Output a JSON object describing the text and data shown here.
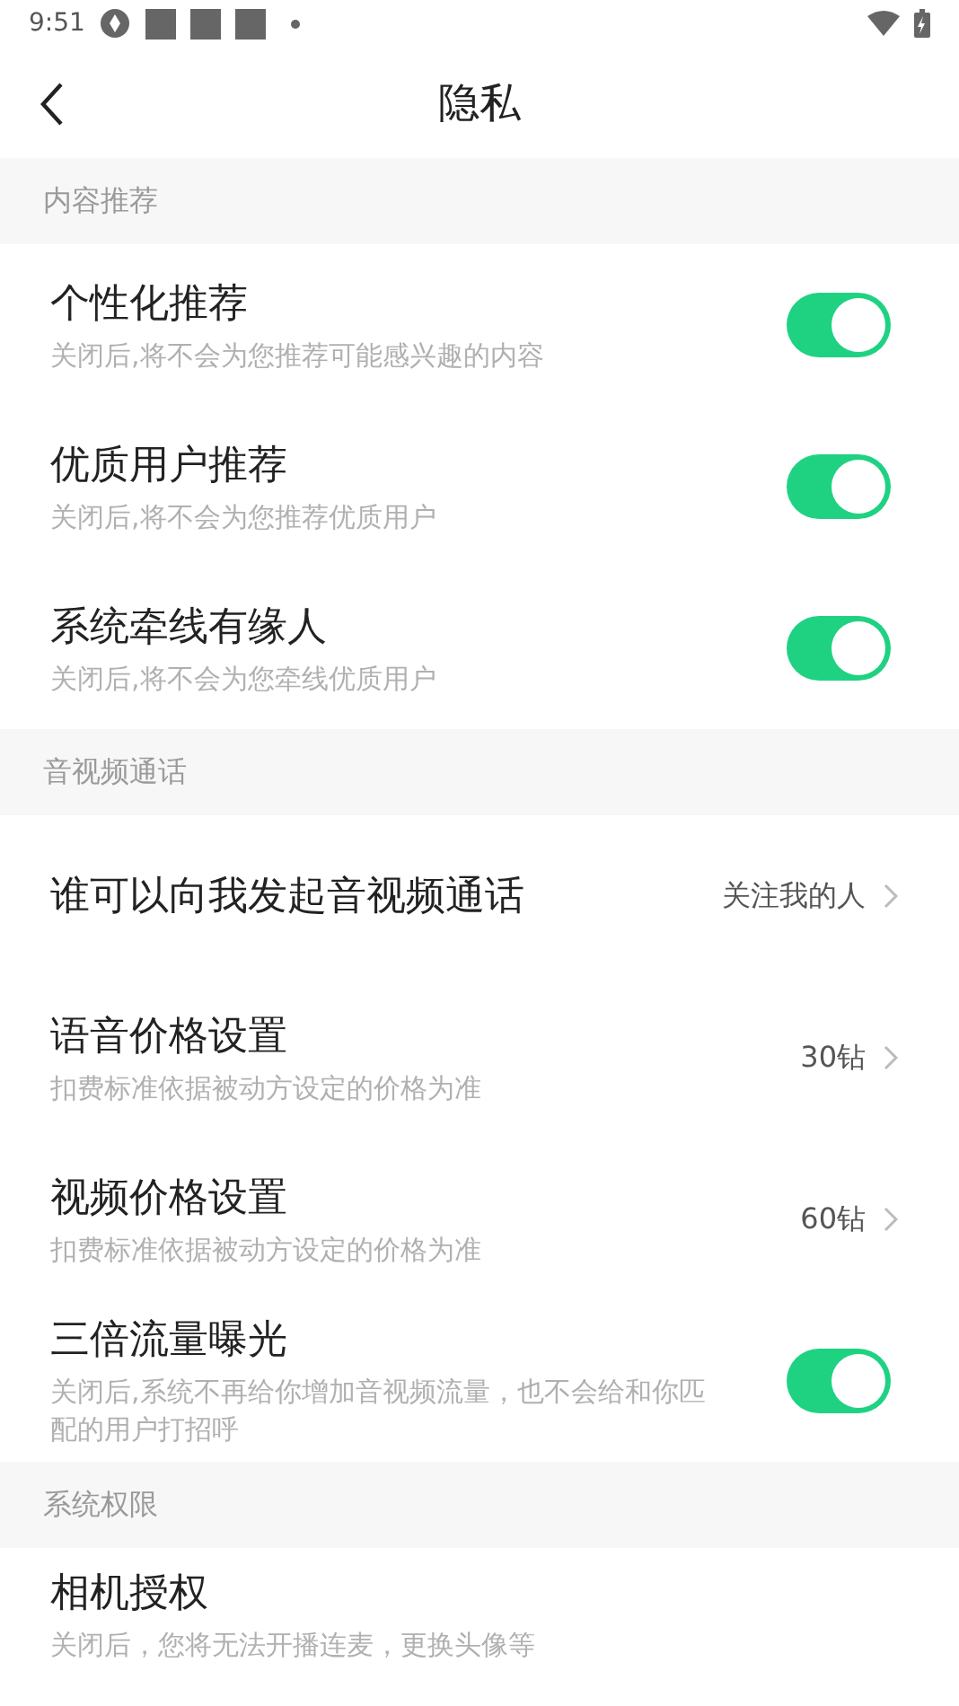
{
  "status_bar": {
    "time": "9:51"
  },
  "header": {
    "title": "隐私"
  },
  "sections": [
    {
      "title": "内容推荐",
      "items": [
        {
          "kind": "toggle",
          "title": "个性化推荐",
          "subtitle": "关闭后,将不会为您推荐可能感兴趣的内容",
          "on": true
        },
        {
          "kind": "toggle",
          "title": "优质用户推荐",
          "subtitle": "关闭后,将不会为您推荐优质用户",
          "on": true
        },
        {
          "kind": "toggle",
          "title": "系统牵线有缘人",
          "subtitle": "关闭后,将不会为您牵线优质用户",
          "on": true
        }
      ]
    },
    {
      "title": "音视频通话",
      "items": [
        {
          "kind": "link",
          "title": "谁可以向我发起音视频通话",
          "value": "关注我的人"
        },
        {
          "kind": "link",
          "title": "语音价格设置",
          "subtitle": "扣费标准依据被动方设定的价格为准",
          "value": "30钻"
        },
        {
          "kind": "link",
          "title": "视频价格设置",
          "subtitle": "扣费标准依据被动方设定的价格为准",
          "value": "60钻"
        },
        {
          "kind": "toggle",
          "title": "三倍流量曝光",
          "subtitle": "关闭后,系统不再给你增加音视频流量，也不会给和你匹配的用户打招呼",
          "on": true
        }
      ]
    },
    {
      "title": "系统权限",
      "items": [
        {
          "kind": "plain",
          "title": "相机授权",
          "subtitle": "关闭后，您将无法开播连麦，更换头像等"
        }
      ]
    }
  ]
}
